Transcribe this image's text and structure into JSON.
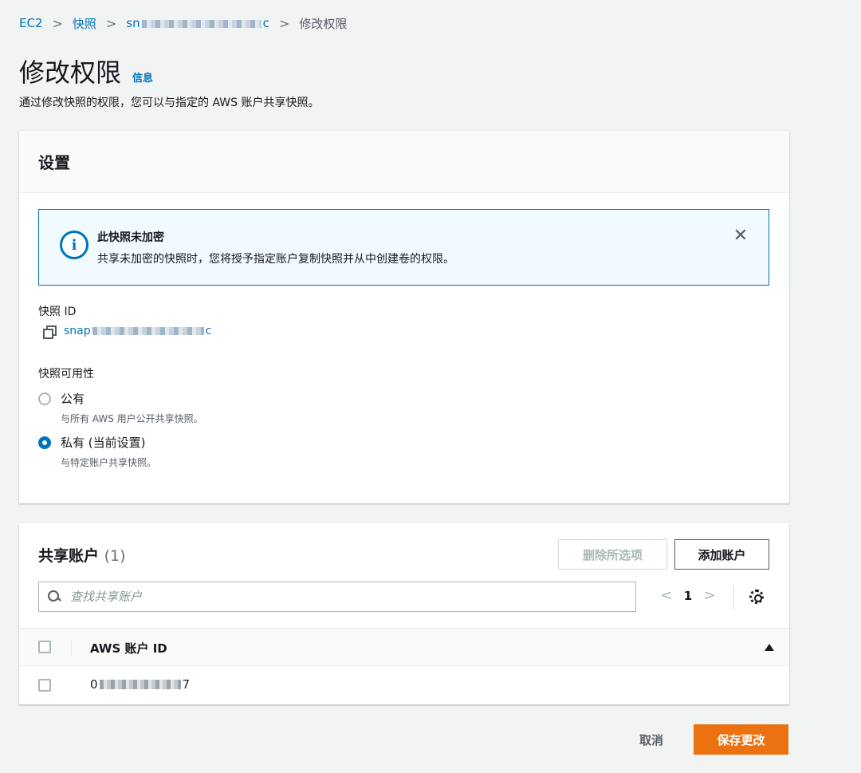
{
  "breadcrumb": {
    "items": [
      "EC2",
      "快照"
    ],
    "snapshot_prefix": "sn",
    "snapshot_suffix": "c",
    "current": "修改权限",
    "separator": ">"
  },
  "header": {
    "title": "修改权限",
    "info_link": "信息",
    "description": "通过修改快照的权限，您可以与指定的 AWS 账户共享快照。"
  },
  "settings": {
    "title": "设置",
    "alert": {
      "icon": "info-icon",
      "title": "此快照未加密",
      "body": "共享未加密的快照时，您将授予指定账户复制快照并从中创建卷的权限。"
    },
    "snapshot_id_label": "快照 ID",
    "snapshot_id_prefix": "snap",
    "snapshot_id_suffix": "c",
    "availability_label": "快照可用性",
    "options": [
      {
        "label": "公有",
        "description": "与所有 AWS 用户公开共享快照。",
        "checked": false
      },
      {
        "label": "私有 (当前设置)",
        "description": "与特定账户共享快照。",
        "checked": true
      }
    ]
  },
  "shared_accounts": {
    "title": "共享账户",
    "count": "(1)",
    "delete_label": "删除所选项",
    "add_label": "添加账户",
    "search_placeholder": "查找共享账户",
    "page": "1",
    "column_header": "AWS 账户 ID",
    "rows": [
      {
        "prefix": "0",
        "suffix": "7"
      }
    ]
  },
  "footer": {
    "cancel_label": "取消",
    "save_label": "保存更改"
  },
  "colors": {
    "link": "#0073bb",
    "primary_button": "#ec7211",
    "alert_border": "#0073bb",
    "alert_bg": "#f1faff"
  }
}
